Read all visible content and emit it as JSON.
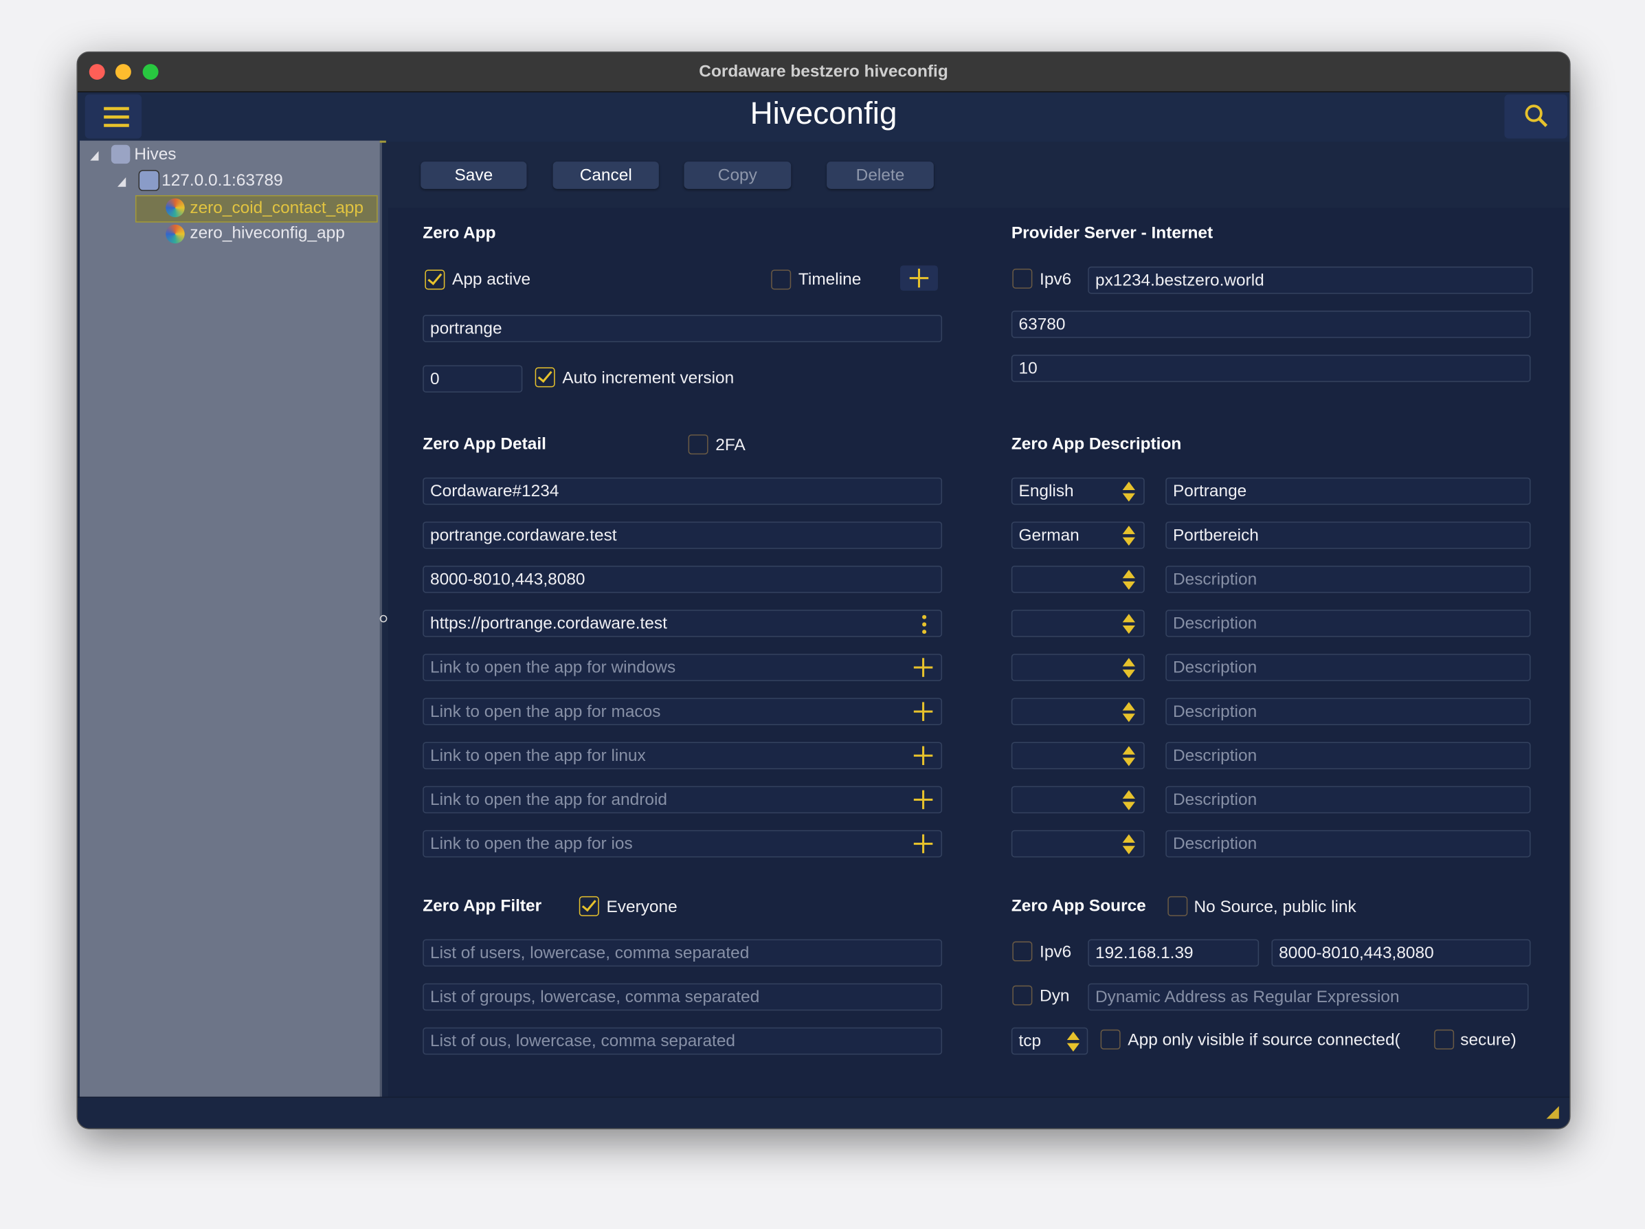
{
  "window": {
    "title": "Cordaware bestzero hiveconfig"
  },
  "header": {
    "title": "Hiveconfig",
    "menu_icon": "hamburger-icon",
    "search_icon": "search-icon"
  },
  "colors": {
    "accent": "#e7c22c",
    "background": "#1b2742",
    "sidebar": "#6d7588"
  },
  "sidebar": {
    "root": "Hives",
    "server": "127.0.0.1:63789",
    "apps": [
      "zero_coid_contact_app",
      "zero_hiveconfig_app"
    ],
    "selected": "zero_coid_contact_app"
  },
  "toolbar": {
    "save": "Save",
    "cancel": "Cancel",
    "copy": "Copy",
    "delete": "Delete"
  },
  "zero_app": {
    "heading": "Zero App",
    "app_active_label": "App active",
    "app_active": true,
    "timeline_label": "Timeline",
    "timeline": false,
    "name": "portrange",
    "version": "0",
    "auto_increment_label": "Auto increment version",
    "auto_increment": true
  },
  "detail": {
    "heading": "Zero App Detail",
    "twofa_label": "2FA",
    "twofa": false,
    "owner": "Cordaware#1234",
    "host": "portrange.cordaware.test",
    "ports": "8000-8010,443,8080",
    "url": "https://portrange.cordaware.test",
    "links": [
      {
        "placeholder": "Link to open the app for windows"
      },
      {
        "placeholder": "Link to open the app for macos"
      },
      {
        "placeholder": "Link to open the app for linux"
      },
      {
        "placeholder": "Link to open the app for android"
      },
      {
        "placeholder": "Link to open the app for ios"
      }
    ]
  },
  "filter": {
    "heading": "Zero App Filter",
    "everyone_label": "Everyone",
    "everyone": true,
    "users_placeholder": "List of users, lowercase, comma separated",
    "groups_placeholder": "List of groups, lowercase, comma separated",
    "ous_placeholder": "List of ous, lowercase, comma separated"
  },
  "provider": {
    "heading": "Provider Server - Internet",
    "ipv6_label": "Ipv6",
    "ipv6": false,
    "host": "px1234.bestzero.world",
    "port": "63780",
    "value3": "10"
  },
  "description": {
    "heading": "Zero App Description",
    "rows": [
      {
        "language": "English",
        "text": "Portrange"
      },
      {
        "language": "German",
        "text": "Portbereich"
      },
      {
        "language": "",
        "placeholder": "Description"
      },
      {
        "language": "",
        "placeholder": "Description"
      },
      {
        "language": "",
        "placeholder": "Description"
      },
      {
        "language": "",
        "placeholder": "Description"
      },
      {
        "language": "",
        "placeholder": "Description"
      },
      {
        "language": "",
        "placeholder": "Description"
      },
      {
        "language": "",
        "placeholder": "Description"
      }
    ]
  },
  "source": {
    "heading": "Zero App Source",
    "no_source_label": "No Source, public link",
    "no_source": false,
    "ipv6_label": "Ipv6",
    "ipv6": false,
    "address": "192.168.1.39",
    "ports": "8000-8010,443,8080",
    "dyn_label": "Dyn",
    "dyn": false,
    "dyn_placeholder": "Dynamic Address as Regular Expression",
    "protocol": "tcp",
    "visible_label": "App only visible if source connected(",
    "visible": false,
    "secure_label": "secure)",
    "secure": false
  }
}
